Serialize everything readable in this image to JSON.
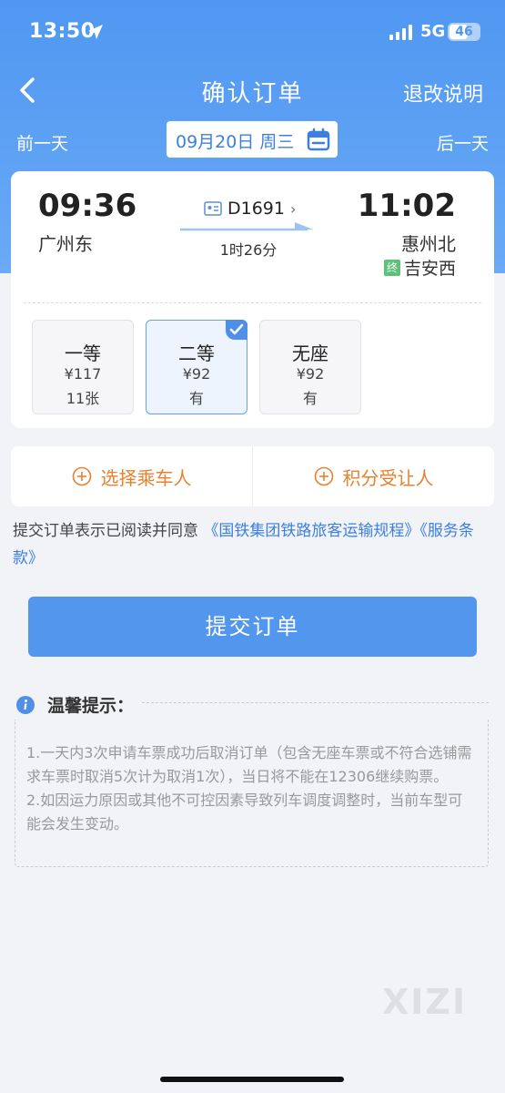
{
  "status": {
    "time": "13:50",
    "network": "5G",
    "battery": "46"
  },
  "nav": {
    "title": "确认订单",
    "right_link": "退改说明"
  },
  "date_bar": {
    "prev": "前一天",
    "date": "09月20日 周三",
    "next": "后一天"
  },
  "trip": {
    "depart_time": "09:36",
    "depart_station": "广州东",
    "arrive_time": "11:02",
    "arrive_station": "惠州北",
    "train_no": "D1691",
    "duration": "1时26分",
    "terminal_tag": "终",
    "terminal_station": "吉安西"
  },
  "seats": [
    {
      "name": "一等",
      "price": "¥117",
      "availability": "11张",
      "selected": false
    },
    {
      "name": "二等",
      "price": "¥92",
      "availability": "有",
      "selected": true
    },
    {
      "name": "无座",
      "price": "¥92",
      "availability": "有",
      "selected": false
    }
  ],
  "actions": {
    "select_passenger": "选择乘车人",
    "points_transfer": "积分受让人"
  },
  "agreement": {
    "text": "提交订单表示已阅读并同意 ",
    "link1": "《国铁集团铁路旅客运输规程》",
    "link2": "《服务条款》"
  },
  "submit_label": "提交订单",
  "tips": {
    "title": "温馨提示：",
    "lines": [
      "1.一天内3次申请车票成功后取消订单（包含无座车票或不符合选铺需求车票时取消5次计为取消1次），当日将不能在12306继续购票。",
      "2.如因运力原因或其他不可控因素导致列车调度调整时，当前车型可能会发生变动。"
    ]
  },
  "watermark": "XIZI",
  "colors": {
    "primary": "#5396ee",
    "header": "#4f97f2",
    "accent_orange": "#e8812f",
    "link": "#3b7fe0"
  }
}
